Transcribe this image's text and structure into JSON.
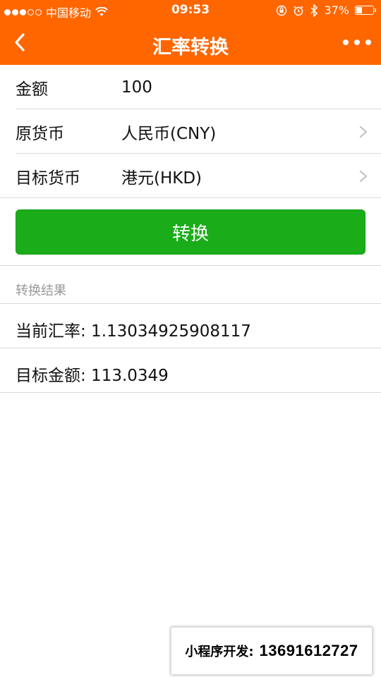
{
  "status_bar": {
    "carrier": "中国移动",
    "time": "09:53",
    "battery_text": "37%",
    "battery_level": 0.37,
    "icons": [
      "signal-dots",
      "wifi-icon",
      "orientation-lock-icon",
      "alarm-icon",
      "bluetooth-icon",
      "battery-icon"
    ]
  },
  "nav": {
    "title": "汇率转换",
    "back_icon": "chevron-left-icon",
    "more_icon": "ellipsis-icon"
  },
  "colors": {
    "nav_background": "#ff6600",
    "primary_button": "#1aad19"
  },
  "form": {
    "amount": {
      "label": "金额",
      "value": "100"
    },
    "source_currency": {
      "label": "原货币",
      "value": "人民币(CNY)",
      "icon": "chevron-right-icon"
    },
    "target_currency": {
      "label": "目标货币",
      "value": "港元(HKD)",
      "icon": "chevron-right-icon"
    },
    "convert_button": "转换"
  },
  "results": {
    "title": "转换结果",
    "rate_text": "当前汇率: 1.13034925908117",
    "amount_text": "目标金额: 113.0349"
  },
  "ad": {
    "label": "小程序开发:",
    "phone": "13691612727"
  }
}
